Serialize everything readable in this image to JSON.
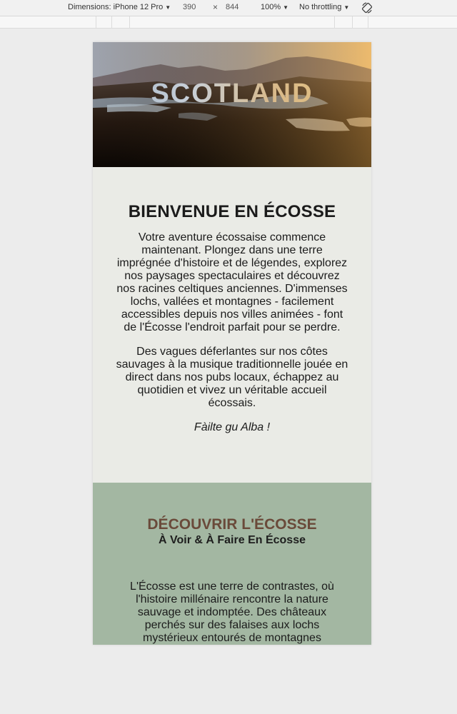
{
  "devtools": {
    "device_label": "Dimensions: iPhone 12 Pro",
    "width": "390",
    "times": "×",
    "height": "844",
    "zoom": "100%",
    "throttling": "No throttling",
    "rotate_icon": "rotate-icon"
  },
  "hero": {
    "title": "SCOTLAND"
  },
  "welcome": {
    "heading": "BIENVENUE EN ÉCOSSE",
    "paragraph1": "Votre aventure écossaise commence maintenant. Plongez dans une terre imprégnée d'histoire et de légendes, explorez nos paysages spectaculaires et découvrez nos racines celtiques anciennes. D'immenses lochs, vallées et montagnes - facilement accessibles depuis nos villes animées - font de l'Écosse l'endroit parfait pour se perdre.",
    "paragraph2": "Des vagues déferlantes sur nos côtes sauvages à la musique traditionnelle jouée en direct dans nos pubs locaux, échappez au quotidien et vivez un véritable accueil écossais.",
    "motto": "Fàilte gu Alba !"
  },
  "discover": {
    "heading": "DÉCOUVRIR L'ÉCOSSE",
    "subheading": "À Voir & À Faire En Écosse",
    "paragraph": "L'Écosse est une terre de contrastes, où l'histoire millénaire rencontre la nature sauvage et indomptée. Des châteaux perchés sur des falaises aux lochs mystérieux entourés de montagnes"
  },
  "colors": {
    "page_bg": "#ececec",
    "welcome_bg": "#eaebe6",
    "discover_bg": "#a3b7a2",
    "discover_heading": "#6a4a3a"
  }
}
